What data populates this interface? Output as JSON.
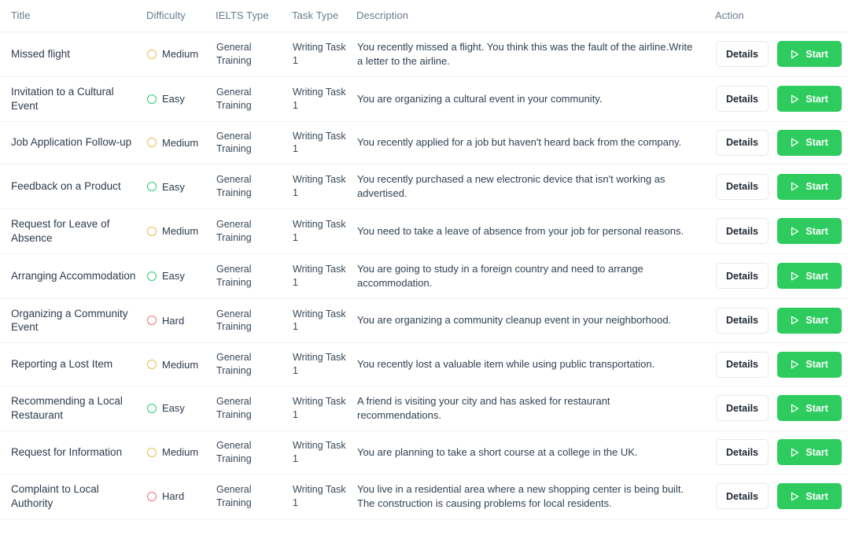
{
  "table": {
    "columns": [
      {
        "key": "title",
        "label": "Title"
      },
      {
        "key": "difficulty",
        "label": "Difficulty"
      },
      {
        "key": "ielts_type",
        "label": "IELTS Type"
      },
      {
        "key": "task_type",
        "label": "Task Type"
      },
      {
        "key": "description",
        "label": "Description"
      },
      {
        "key": "action",
        "label": "Action"
      }
    ],
    "buttons": {
      "details_label": "Details",
      "start_label": "Start",
      "start_icon": "play-icon"
    },
    "colors": {
      "easy": "#2ecc71",
      "medium": "#e3c04a",
      "hard": "#ec6f7f",
      "start_button": "#2ecc5f",
      "header_text": "#6b7a90",
      "body_text": "#2f3a4d",
      "row_divider": "#eef1f5"
    },
    "rows": [
      {
        "title": "Missed flight",
        "difficulty": "Medium",
        "difficulty_level": "medium",
        "ielts_type": "General Training",
        "task_type": "Writing Task 1",
        "description": "You recently missed a flight. You think this was the fault of the airline.Write a letter to the airline."
      },
      {
        "title": "Invitation to a Cultural Event",
        "difficulty": "Easy",
        "difficulty_level": "easy",
        "ielts_type": "General Training",
        "task_type": "Writing Task 1",
        "description": "You are organizing a cultural event in your community."
      },
      {
        "title": "Job Application Follow-up",
        "difficulty": "Medium",
        "difficulty_level": "medium",
        "ielts_type": "General Training",
        "task_type": "Writing Task 1",
        "description": "You recently applied for a job but haven't heard back from the company."
      },
      {
        "title": "Feedback on a Product",
        "difficulty": "Easy",
        "difficulty_level": "easy",
        "ielts_type": "General Training",
        "task_type": "Writing Task 1",
        "description": "You recently purchased a new electronic device that isn't working as advertised."
      },
      {
        "title": "Request for Leave of Absence",
        "difficulty": "Medium",
        "difficulty_level": "medium",
        "ielts_type": "General Training",
        "task_type": "Writing Task 1",
        "description": "You need to take a leave of absence from your job for personal reasons."
      },
      {
        "title": "Arranging Accommodation",
        "difficulty": "Easy",
        "difficulty_level": "easy",
        "ielts_type": "General Training",
        "task_type": "Writing Task 1",
        "description": "You are going to study in a foreign country and need to arrange accommodation."
      },
      {
        "title": "Organizing a Community Event",
        "difficulty": "Hard",
        "difficulty_level": "hard",
        "ielts_type": "General Training",
        "task_type": "Writing Task 1",
        "description": "You are organizing a community cleanup event in your neighborhood."
      },
      {
        "title": "Reporting a Lost Item",
        "difficulty": "Medium",
        "difficulty_level": "medium",
        "ielts_type": "General Training",
        "task_type": "Writing Task 1",
        "description": "You recently lost a valuable item while using public transportation."
      },
      {
        "title": "Recommending a Local Restaurant",
        "difficulty": "Easy",
        "difficulty_level": "easy",
        "ielts_type": "General Training",
        "task_type": "Writing Task 1",
        "description": "A friend is visiting your city and has asked for restaurant recommendations."
      },
      {
        "title": "Request for Information",
        "difficulty": "Medium",
        "difficulty_level": "medium",
        "ielts_type": "General Training",
        "task_type": "Writing Task 1",
        "description": "You are planning to take a short course at a college in the UK."
      },
      {
        "title": "Complaint to Local Authority",
        "difficulty": "Hard",
        "difficulty_level": "hard",
        "ielts_type": "General Training",
        "task_type": "Writing Task 1",
        "description": "You live in a residential area where a new shopping center is being built. The construction is causing problems for local residents."
      }
    ]
  }
}
